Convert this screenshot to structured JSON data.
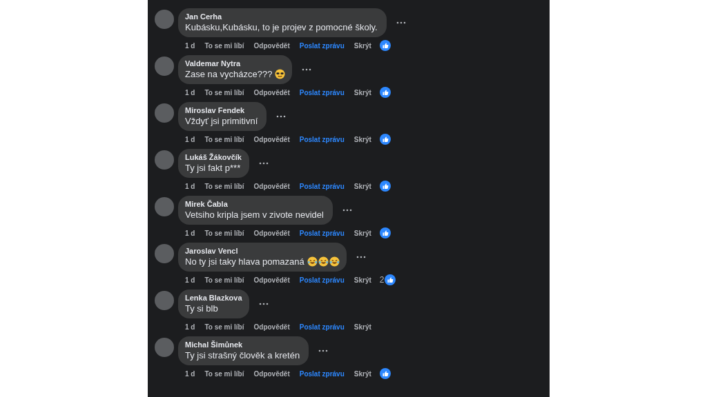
{
  "comments": [
    {
      "author": "Jan Cerha",
      "text": "Kubásku,Kubásku, to je projev z pomocné školy.",
      "time": "1 d",
      "like": "To se mi líbí",
      "reply": "Odpovědět",
      "message": "Poslat zprávu",
      "hide": "Skrýt",
      "reacted": true
    },
    {
      "author": "Valdemar Nytra",
      "text": "Zase na vycházce???",
      "emojis": [
        {
          "kind": "sunglasses"
        }
      ],
      "time": "1 d",
      "like": "To se mi líbí",
      "reply": "Odpovědět",
      "message": "Poslat zprávu",
      "hide": "Skrýt",
      "reacted": true
    },
    {
      "author": "Miroslav Fendek",
      "text": "Vždyť jsi primitivní",
      "time": "1 d",
      "like": "To se mi líbí",
      "reply": "Odpovědět",
      "message": "Poslat zprávu",
      "hide": "Skrýt",
      "reacted": true
    },
    {
      "author": "Lukáš Žákovčík",
      "text": "Ty jsi fakt p***",
      "time": "1 d",
      "like": "To se mi líbí",
      "reply": "Odpovědět",
      "message": "Poslat zprávu",
      "hide": "Skrýt",
      "reacted": true
    },
    {
      "author": "Mirek Čabla",
      "text": "Vetsiho kripla jsem v zivote nevidel",
      "time": "1 d",
      "like": "To se mi líbí",
      "reply": "Odpovědět",
      "message": "Poslat zprávu",
      "hide": "Skrýt",
      "reacted": true
    },
    {
      "author": "Jaroslav Vencl",
      "text": "No ty jsi taky hlava pomazaná",
      "emojis": [
        {
          "kind": "laughing"
        },
        {
          "kind": "laughing"
        },
        {
          "kind": "laughing"
        }
      ],
      "time": "1 d",
      "like": "To se mi líbí",
      "reply": "Odpovědět",
      "message": "Poslat zprávu",
      "hide": "Skrýt",
      "reacted": true,
      "reaction_count": "2"
    },
    {
      "author": "Lenka Blazkova",
      "text": "Ty si blb",
      "time": "1 d",
      "like": "To se mi líbí",
      "reply": "Odpovědět",
      "message": "Poslat zprávu",
      "hide": "Skrýt",
      "reacted": false
    },
    {
      "author": "Michal Šimůnek",
      "text": "Ty jsi strašný člověk a kretén",
      "time": "1 d",
      "like": "To se mi líbí",
      "reply": "Odpovědět",
      "message": "Poslat zprávu",
      "hide": "Skrýt",
      "reacted": true
    }
  ]
}
